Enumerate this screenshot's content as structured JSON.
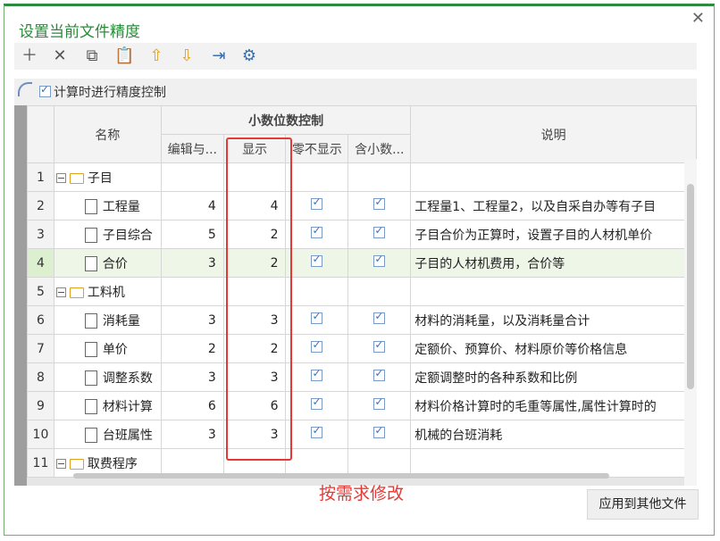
{
  "dialog": {
    "title": "设置当前文件精度",
    "close_glyph": "✕"
  },
  "toolbar": {
    "icons": [
      "add-icon",
      "delete-icon",
      "copy-icon",
      "paste-icon",
      "move-up-icon",
      "move-down-icon",
      "export-icon",
      "settings-refresh-icon"
    ]
  },
  "precision_checkbox": {
    "label": "计算时进行精度控制",
    "checked": true
  },
  "table": {
    "headers": {
      "name": "名称",
      "group": "小数位数控制",
      "edit": "编辑与...",
      "display": "显示",
      "zero_hide": "零不显示",
      "round": "含小数...",
      "desc": "说明"
    },
    "rows": [
      {
        "no": "1",
        "type": "folder",
        "name": "子目",
        "edit": "",
        "display": "",
        "zero": false,
        "round": false,
        "desc": ""
      },
      {
        "no": "2",
        "type": "doc",
        "name": "工程量",
        "edit": "4",
        "display": "4",
        "zero": true,
        "round": true,
        "desc": "工程量1、工程量2，以及自采自办等有子目"
      },
      {
        "no": "3",
        "type": "doc",
        "name": "子目综合",
        "edit": "5",
        "display": "2",
        "zero": true,
        "round": true,
        "desc": "子目合价为正算时，设置子目的人材机单价"
      },
      {
        "no": "4",
        "type": "doc",
        "name": "合价",
        "edit": "3",
        "display": "2",
        "zero": true,
        "round": true,
        "desc": "子目的人材机费用，合价等",
        "selected": true
      },
      {
        "no": "5",
        "type": "folder",
        "name": "工料机",
        "edit": "",
        "display": "",
        "zero": false,
        "round": false,
        "desc": ""
      },
      {
        "no": "6",
        "type": "doc",
        "name": "消耗量",
        "edit": "3",
        "display": "3",
        "zero": true,
        "round": true,
        "desc": "材料的消耗量，以及消耗量合计"
      },
      {
        "no": "7",
        "type": "doc",
        "name": "单价",
        "edit": "2",
        "display": "2",
        "zero": true,
        "round": true,
        "desc": "定额价、预算价、材料原价等价格信息"
      },
      {
        "no": "8",
        "type": "doc",
        "name": "调整系数",
        "edit": "3",
        "display": "3",
        "zero": true,
        "round": true,
        "desc": "定额调整时的各种系数和比例"
      },
      {
        "no": "9",
        "type": "doc",
        "name": "材料计算",
        "edit": "6",
        "display": "6",
        "zero": true,
        "round": true,
        "desc": "材料价格计算时的毛重等属性,属性计算时的"
      },
      {
        "no": "10",
        "type": "doc",
        "name": "台班属性",
        "edit": "3",
        "display": "3",
        "zero": true,
        "round": true,
        "desc": "机械的台班消耗"
      },
      {
        "no": "11",
        "type": "folder",
        "name": "取费程序",
        "edit": "",
        "display": "",
        "zero": false,
        "round": false,
        "desc": ""
      }
    ]
  },
  "annotation": {
    "text": "按需求修改",
    "color": "#e53935"
  },
  "apply_button": {
    "label": "应用到其他文件"
  }
}
